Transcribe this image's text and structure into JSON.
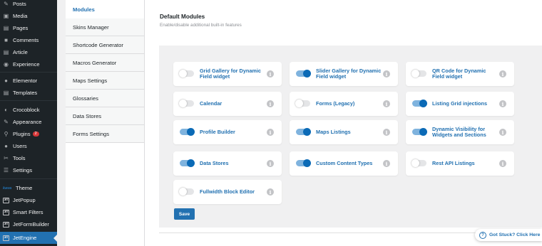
{
  "sidebar": {
    "items": [
      {
        "label": "Posts",
        "icon": "pin-icon"
      },
      {
        "label": "Media",
        "icon": "media-icon"
      },
      {
        "label": "Pages",
        "icon": "pages-icon"
      },
      {
        "label": "Comments",
        "icon": "comments-icon"
      },
      {
        "label": "Article",
        "icon": "article-icon"
      },
      {
        "label": "Experience",
        "icon": "experience-icon"
      },
      {
        "label": "Elementor",
        "icon": "elementor-icon"
      },
      {
        "label": "Templates",
        "icon": "templates-icon"
      },
      {
        "label": "Crocoblock",
        "icon": "crocoblock-icon"
      },
      {
        "label": "Appearance",
        "icon": "appearance-icon"
      },
      {
        "label": "Plugins",
        "icon": "plugins-icon",
        "badge": "2"
      },
      {
        "label": "Users",
        "icon": "users-icon"
      },
      {
        "label": "Tools",
        "icon": "tools-icon"
      },
      {
        "label": "Settings",
        "icon": "settings-icon"
      },
      {
        "label": "Theme",
        "icon": "theme-logo",
        "logo_text": "kava"
      },
      {
        "label": "JetPopup",
        "icon": "jetpopup-icon",
        "icon_text": "JET"
      },
      {
        "label": "Smart Filters",
        "icon": "smart-filters-icon",
        "icon_text": "JET"
      },
      {
        "label": "JetFormBuilder",
        "icon": "jetformbuilder-icon",
        "icon_text": "JET"
      },
      {
        "label": "JetEngine",
        "icon": "jetengine-icon",
        "icon_text": "JET",
        "active": true
      }
    ]
  },
  "tabs": [
    {
      "label": "Modules",
      "active": true
    },
    {
      "label": "Skins Manager"
    },
    {
      "label": "Shortcode Generator"
    },
    {
      "label": "Macros Generator"
    },
    {
      "label": "Maps Settings"
    },
    {
      "label": "Glossaries"
    },
    {
      "label": "Data Stores"
    },
    {
      "label": "Forms Settings"
    }
  ],
  "content": {
    "title": "Default Modules",
    "subtitle": "Enable/disable additional built-in features",
    "modules": [
      {
        "label": "Grid Gallery for Dynamic Field widget",
        "enabled": false
      },
      {
        "label": "Slider Gallery for Dynamic Field widget",
        "enabled": true
      },
      {
        "label": "QR Code for Dynamic Field widget",
        "enabled": false
      },
      {
        "label": "Calendar",
        "enabled": false
      },
      {
        "label": "Forms (Legacy)",
        "enabled": false
      },
      {
        "label": "Listing Grid injections",
        "enabled": true
      },
      {
        "label": "Profile Builder",
        "enabled": true
      },
      {
        "label": "Maps Listings",
        "enabled": true
      },
      {
        "label": "Dynamic Visibility for Widgets and Sections",
        "enabled": true
      },
      {
        "label": "Data Stores",
        "enabled": true
      },
      {
        "label": "Custom Content Types",
        "enabled": true
      },
      {
        "label": "Rest API Listings",
        "enabled": false
      },
      {
        "label": "Fullwidth Block Editor",
        "enabled": false
      }
    ],
    "info_glyph": "i",
    "save_label": "Save"
  },
  "help": {
    "label": "Got Stuck? Click Here",
    "icon_glyph": "?"
  },
  "colors": {
    "accent": "#2271b1",
    "toggle_on": "#0b6ab6",
    "sidebar_bg": "#1d2327"
  }
}
